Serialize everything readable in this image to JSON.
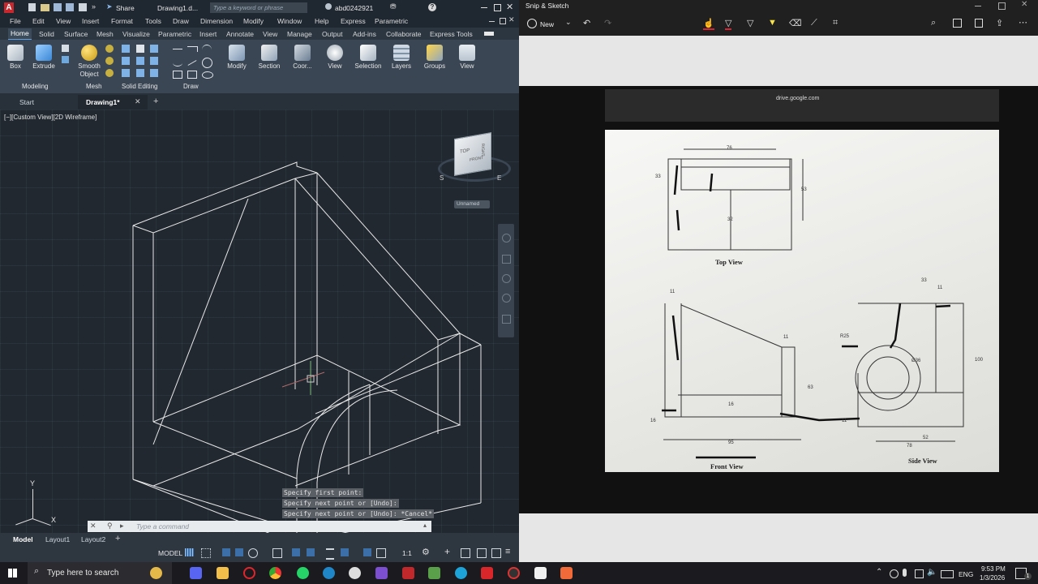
{
  "autocad": {
    "title": {
      "share": "Share",
      "filename": "Drawing1.d...",
      "search_placeholder": "Type a keyword or phrase",
      "user": "abd0242921"
    },
    "menu": [
      "File",
      "Edit",
      "View",
      "Insert",
      "Format",
      "Tools",
      "Draw",
      "Dimension",
      "Modify",
      "Window",
      "Help",
      "Express",
      "Parametric"
    ],
    "ribbon_tabs": [
      "Home",
      "Solid",
      "Surface",
      "Mesh",
      "Visualize",
      "Parametric",
      "Insert",
      "Annotate",
      "View",
      "Manage",
      "Output",
      "Add-ins",
      "Collaborate",
      "Express Tools"
    ],
    "ribbon_tools": [
      "Box",
      "Extrude",
      "Smooth Object",
      "Modify",
      "Section",
      "Coor...",
      "View",
      "Selection",
      "Layers",
      "Groups",
      "View"
    ],
    "panel_groups": [
      "Modeling",
      "Mesh",
      "Solid Editing",
      "Draw"
    ],
    "doc_tabs": {
      "start": "Start",
      "drawing": "Drawing1*"
    },
    "viewport_label": "[−][Custom View][2D Wireframe]",
    "viewcube": {
      "top": "TOP",
      "front": "FRONT",
      "right": "RIGHT",
      "compass_s": "S",
      "compass_e": "E",
      "named_view": "Unnamed"
    },
    "ucs": {
      "x": "X",
      "y": "Y"
    },
    "command_history": [
      "Specify first point:",
      "Specify next point or [Undo]:",
      "Specify next point or [Undo]: *Cancel*"
    ],
    "command_placeholder": "Type a command",
    "layout_tabs": [
      "Model",
      "Layout1",
      "Layout2"
    ],
    "status": {
      "model": "MODEL",
      "scale": "1:1"
    }
  },
  "snip": {
    "app_title": "Snip & Sketch",
    "new_label": "New",
    "url": "drive.google.com",
    "sheet": {
      "top_view": "Top View",
      "front_view": "Front View",
      "side_view": "Side View",
      "dims": [
        "76",
        "33",
        "53",
        "32",
        "11",
        "11",
        "63",
        "16",
        "16",
        "95",
        "33",
        "11",
        "R25",
        "Ø36",
        "100",
        "52",
        "78",
        "11"
      ]
    }
  },
  "taskbar": {
    "search_placeholder": "Type here to search",
    "language": "ENG",
    "time": "9:53 PM",
    "date": "1/3/2026",
    "notification_count": "1"
  },
  "colors": {
    "accent": "#5ea0e6",
    "wire": "#e8e8e8",
    "autocad_red": "#c8282d"
  }
}
